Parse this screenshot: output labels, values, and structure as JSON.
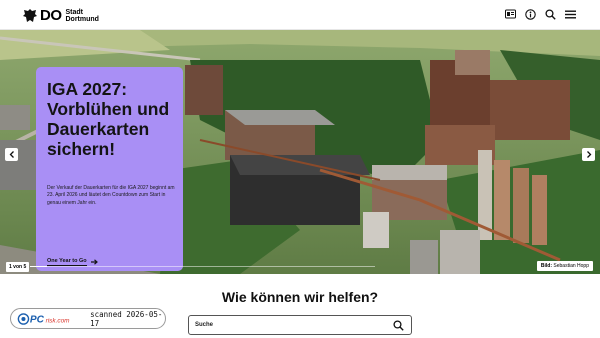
{
  "header": {
    "logo": {
      "mark": "DO",
      "line1": "Stadt",
      "line2": "Dortmund"
    },
    "icons": [
      "sign-language-icon",
      "easy-language-icon",
      "search-icon",
      "menu-icon"
    ]
  },
  "hero": {
    "promo": {
      "title": "IGA 2027: Vorblühen und Dauer­karten sichern!",
      "body": "Der Verkauf der Dauerkarten für die IGA 2027 beginnt am 23. April 2026 und läutet den Countdown zum Start in genau einem Jahr ein.",
      "link": "One Year to Go",
      "color": "#a98ff5"
    },
    "counter": "1 von 5",
    "progress": 0.05,
    "credit_label": "Bild:",
    "credit_name": "Sebastian Hopp"
  },
  "help": {
    "title": "Wie können wir helfen?",
    "search_placeholder": "Suche"
  },
  "watermark": {
    "brand": "PCrisk.com",
    "stamp": "scanned 2026-05-17"
  }
}
